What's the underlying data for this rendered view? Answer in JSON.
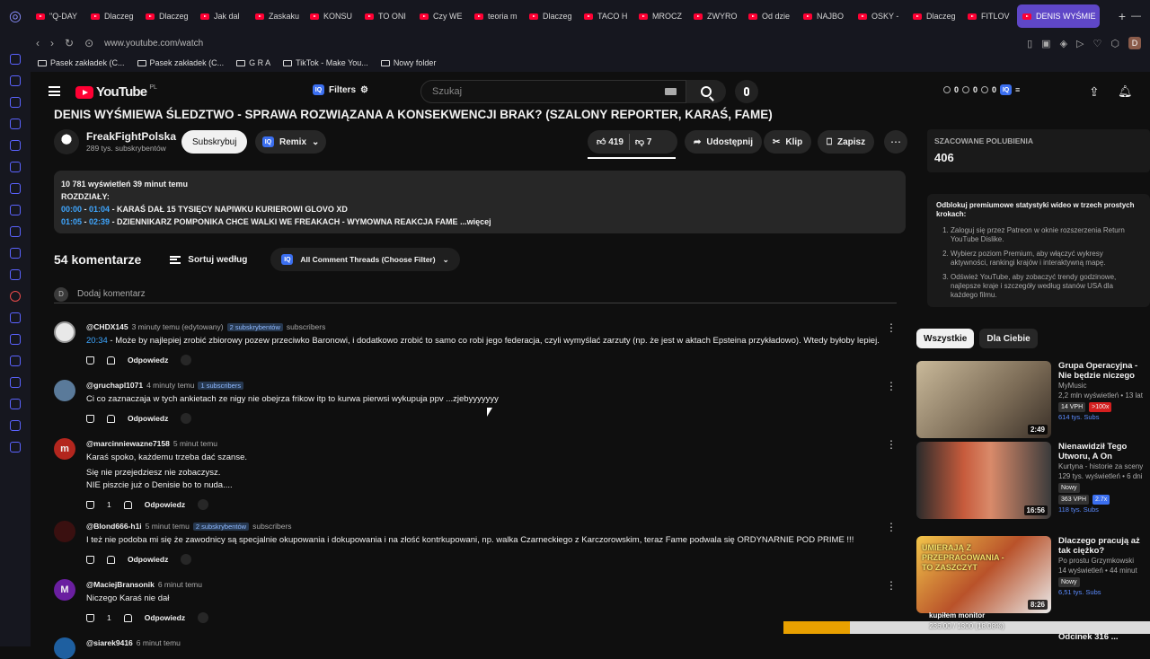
{
  "browser": {
    "tabs": [
      "\"Q-DAY",
      "Dlaczeg",
      "Dlaczeg",
      "Jak dal",
      "Zaskaku",
      "KONSU",
      "TO ONI",
      "Czy WE",
      "teoria m",
      "Dlaczeg",
      "TACO H",
      "MROCZ",
      "ZWYRO",
      "Od dzie",
      "NAJBO",
      "OSKY -",
      "Dlaczeg",
      "FITLOV"
    ],
    "active_tab": "DENIS WYŚMIE",
    "url": "www.youtube.com/watch",
    "profile_initial": "D",
    "bookmarks": [
      "Pasek zakładek (C...",
      "Pasek zakładek (C...",
      "G R A",
      "TikTok - Make You...",
      "Nowy folder"
    ]
  },
  "yt": {
    "logo": "YouTube",
    "region": "PL",
    "filters_label": "Filters",
    "iq": "IQ",
    "search_placeholder": "Szukaj",
    "stats_counts": [
      "0",
      "0",
      "0"
    ]
  },
  "video": {
    "title": "DENIS WYŚMIEWA ŚLEDZTWO - SPRAWA ROZWIĄZANA A KONSEKWENCJI BRAK? (SZALONY REPORTER, KARAŚ, FAME)",
    "channel": "FreakFightPolska",
    "subscribers": "289 tys. subskrybentów",
    "subscribe_label": "Subskrybuj",
    "remix_label": "Remix",
    "likes": "419",
    "dislikes": "7",
    "share_label": "Udostępnij",
    "clip_label": "Klip",
    "save_label": "Zapisz",
    "desc_stats": "10 781 wyświetleń  39 minut temu",
    "desc_heading": "ROZDZIAŁY:",
    "chapters": [
      {
        "start": "00:00",
        "end": "01:04",
        "text": " - KARAŚ DAŁ 15 TYSIĘCY NAPIWKU KURIEROWI GLOVO XD"
      },
      {
        "start": "01:05",
        "end": "02:39",
        "text": " - DZIENNIKARZ POMPONIKA CHCE WALKI WE FREAKACH - WYMOWNA REAKCJA FAME"
      }
    ],
    "more_label": "...więcej"
  },
  "comments": {
    "count_label": "54 komentarze",
    "sort_label": "Sortuj według",
    "filter_label": "All Comment Threads (Choose Filter)",
    "add_placeholder": "Dodaj komentarz",
    "user_initial": "D",
    "reply_label": "Odpowiedz",
    "items": [
      {
        "author": "@CHDX145",
        "time": "3 minuty temu (edytowany)",
        "badge": "2 subskrybentów",
        "badge_suffix": "subscribers",
        "timestamp": "20:34",
        "text": " - Może by najlepiej zrobić zbiorowy pozew przeciwko Baronowi, i dodatkowo zrobić to samo co robi jego federacja, czyli wymyślać zarzuty (np. że jest w aktach Epsteina przykładowo). Wtedy byłoby lepiej.",
        "likes": ""
      },
      {
        "author": "@gruchapl1071",
        "time": "4 minuty temu",
        "badge": "1 subscribers",
        "badge_suffix": "",
        "timestamp": "",
        "text": "Ci co zaznaczaja w tych ankietach ze nigy nie obejrza frikow itp to kurwa pierwsi wykupuja ppv ...zjebyyyyyyy",
        "likes": ""
      },
      {
        "author": "@marcinniewazne7158",
        "time": "5 minut temu",
        "badge": "",
        "badge_suffix": "",
        "timestamp": "",
        "lines": [
          "Karaś spoko, każdemu trzeba dać szanse.",
          "Się nie przejedziesz nie zobaczysz.",
          "NIE piszcie już o Denisie bo to nuda...."
        ],
        "likes": "1"
      },
      {
        "author": "@Blond666-h1i",
        "time": "5 minut temu",
        "badge": "2 subskrybentów",
        "badge_suffix": "subscribers",
        "timestamp": "",
        "text": "I też nie podoba mi się że zawodnicy są specjalnie okupowania i dokupowania i na złość kontrkupowani, np. walka Czarneckiego z Karczorowskim, teraz Fame podwala się ORDYNARNIE POD PRIME !!!",
        "likes": ""
      },
      {
        "author": "@MaciejBransonik",
        "time": "6 minut temu",
        "badge": "",
        "badge_suffix": "",
        "timestamp": "",
        "text": "Niczego Karaś nie dał",
        "likes": "1"
      },
      {
        "author": "@siarek9416",
        "time": "6 minut temu",
        "badge": "",
        "badge_suffix": "",
        "timestamp": "",
        "text": "",
        "likes": ""
      }
    ]
  },
  "right": {
    "stat_label": "SZACOWANE POLUBIENIA",
    "stat_value": "406",
    "premium_title": "Odblokuj premiumowe statystyki wideo w trzech prostych krokach:",
    "premium_steps": [
      "Zaloguj się przez Patreon w oknie rozszerzenia Return YouTube Dislike.",
      "Wybierz poziom Premium, aby włączyć wykresy aktywności, rankingi krajów i interaktywną mapę.",
      "Odśwież YouTube, aby zobaczyć trendy godzinowe, najlepsze kraje i szczegóły według stanów USA dla każdego filmu."
    ],
    "chips": [
      "Wszystkie",
      "Dla Ciebie"
    ],
    "recs": [
      {
        "title": "Grupa Operacyjna - Nie będzie niczego",
        "channel": "MyMusic",
        "meta": "2,2 mln wyświetleń • 13 lat",
        "vph": "14 VPH",
        "tag": ">100x",
        "subs": "614 tys. Subs",
        "duration": "2:49",
        "new": ""
      },
      {
        "title": "Nienawidził Tego Utworu, A On Uratowa...",
        "channel": "Kurtyna - historie za sceny",
        "meta": "129 tys. wyświetleń • 6 dni",
        "vph": "363 VPH",
        "tag": "2.7x",
        "subs": "118 tys. Subs",
        "duration": "16:56",
        "new": "Nowy"
      },
      {
        "title": "Dlaczego pracują aż tak ciężko? Pracoholizm ...",
        "channel": "Po prostu Grzymkowski",
        "meta": "14 wyświetleń • 44 minut",
        "vph": "",
        "tag": "",
        "subs": "6,51 tys. Subs",
        "duration": "8:26",
        "new": "Nowy"
      }
    ],
    "thumb_overlay": "UMIERAJĄ Z PRZEPRACOWANIA - TO ZASZCZYT",
    "next_title": "Odcinek 316 ..."
  },
  "overlay": {
    "title": "kupiłem monitor",
    "progress_text": "236.00 / 1300 (18.08%)",
    "progress": 0.1808
  }
}
